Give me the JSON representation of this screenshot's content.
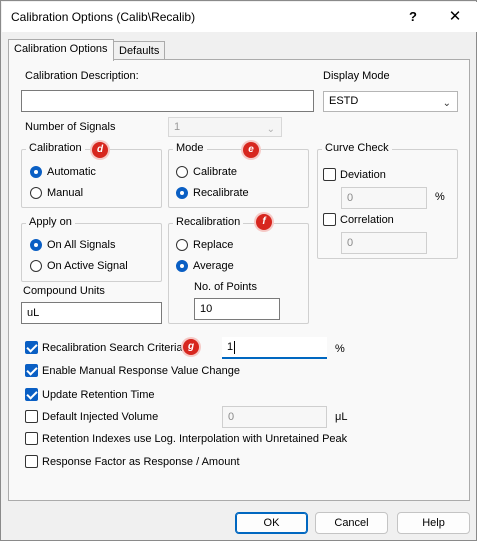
{
  "window": {
    "title": "Calibration Options (Calib\\Recalib)",
    "help_glyph": "?",
    "close_glyph": "✕"
  },
  "tabs": [
    {
      "label": "Calibration Options"
    },
    {
      "label": "Defaults"
    }
  ],
  "fields": {
    "description_label": "Calibration Description:",
    "description_value": "",
    "display_mode_label": "Display Mode",
    "display_mode_value": "ESTD",
    "num_signals_label": "Number of Signals",
    "num_signals_value": "1",
    "compound_units_label": "Compound Units",
    "compound_units_value": "uL"
  },
  "calibration": {
    "title": "Calibration",
    "badge": "d",
    "options": [
      "Automatic",
      "Manual"
    ]
  },
  "mode": {
    "title": "Mode",
    "badge": "e",
    "options": [
      "Calibrate",
      "Recalibrate"
    ]
  },
  "curve_check": {
    "title": "Curve Check",
    "deviation_label": "Deviation",
    "deviation_value": "0",
    "deviation_unit": "%",
    "correlation_label": "Correlation",
    "correlation_value": "0"
  },
  "apply_on": {
    "title": "Apply on",
    "options": [
      "On All Signals",
      "On Active Signal"
    ]
  },
  "recalibration": {
    "title": "Recalibration",
    "badge": "f",
    "options": [
      "Replace",
      "Average"
    ],
    "points_label": "No. of Points",
    "points_value": "10"
  },
  "options": {
    "search_criteria_label": "Recalibration Search Criteria",
    "search_badge": "g",
    "search_value": "1",
    "search_unit": "%",
    "manual_response_label": "Enable Manual Response Value Change",
    "update_rt_label": "Update Retention Time",
    "default_volume_label": "Default Injected Volume",
    "default_volume_value": "0",
    "default_volume_unit": "μL",
    "retention_index_label": "Retention Indexes use Log. Interpolation with Unretained Peak",
    "response_factor_label": "Response Factor as Response / Amount"
  },
  "buttons": {
    "ok": "OK",
    "cancel": "Cancel",
    "help": "Help"
  },
  "colors": {
    "accent": "#0a5fc4",
    "badge": "#d7261e"
  }
}
